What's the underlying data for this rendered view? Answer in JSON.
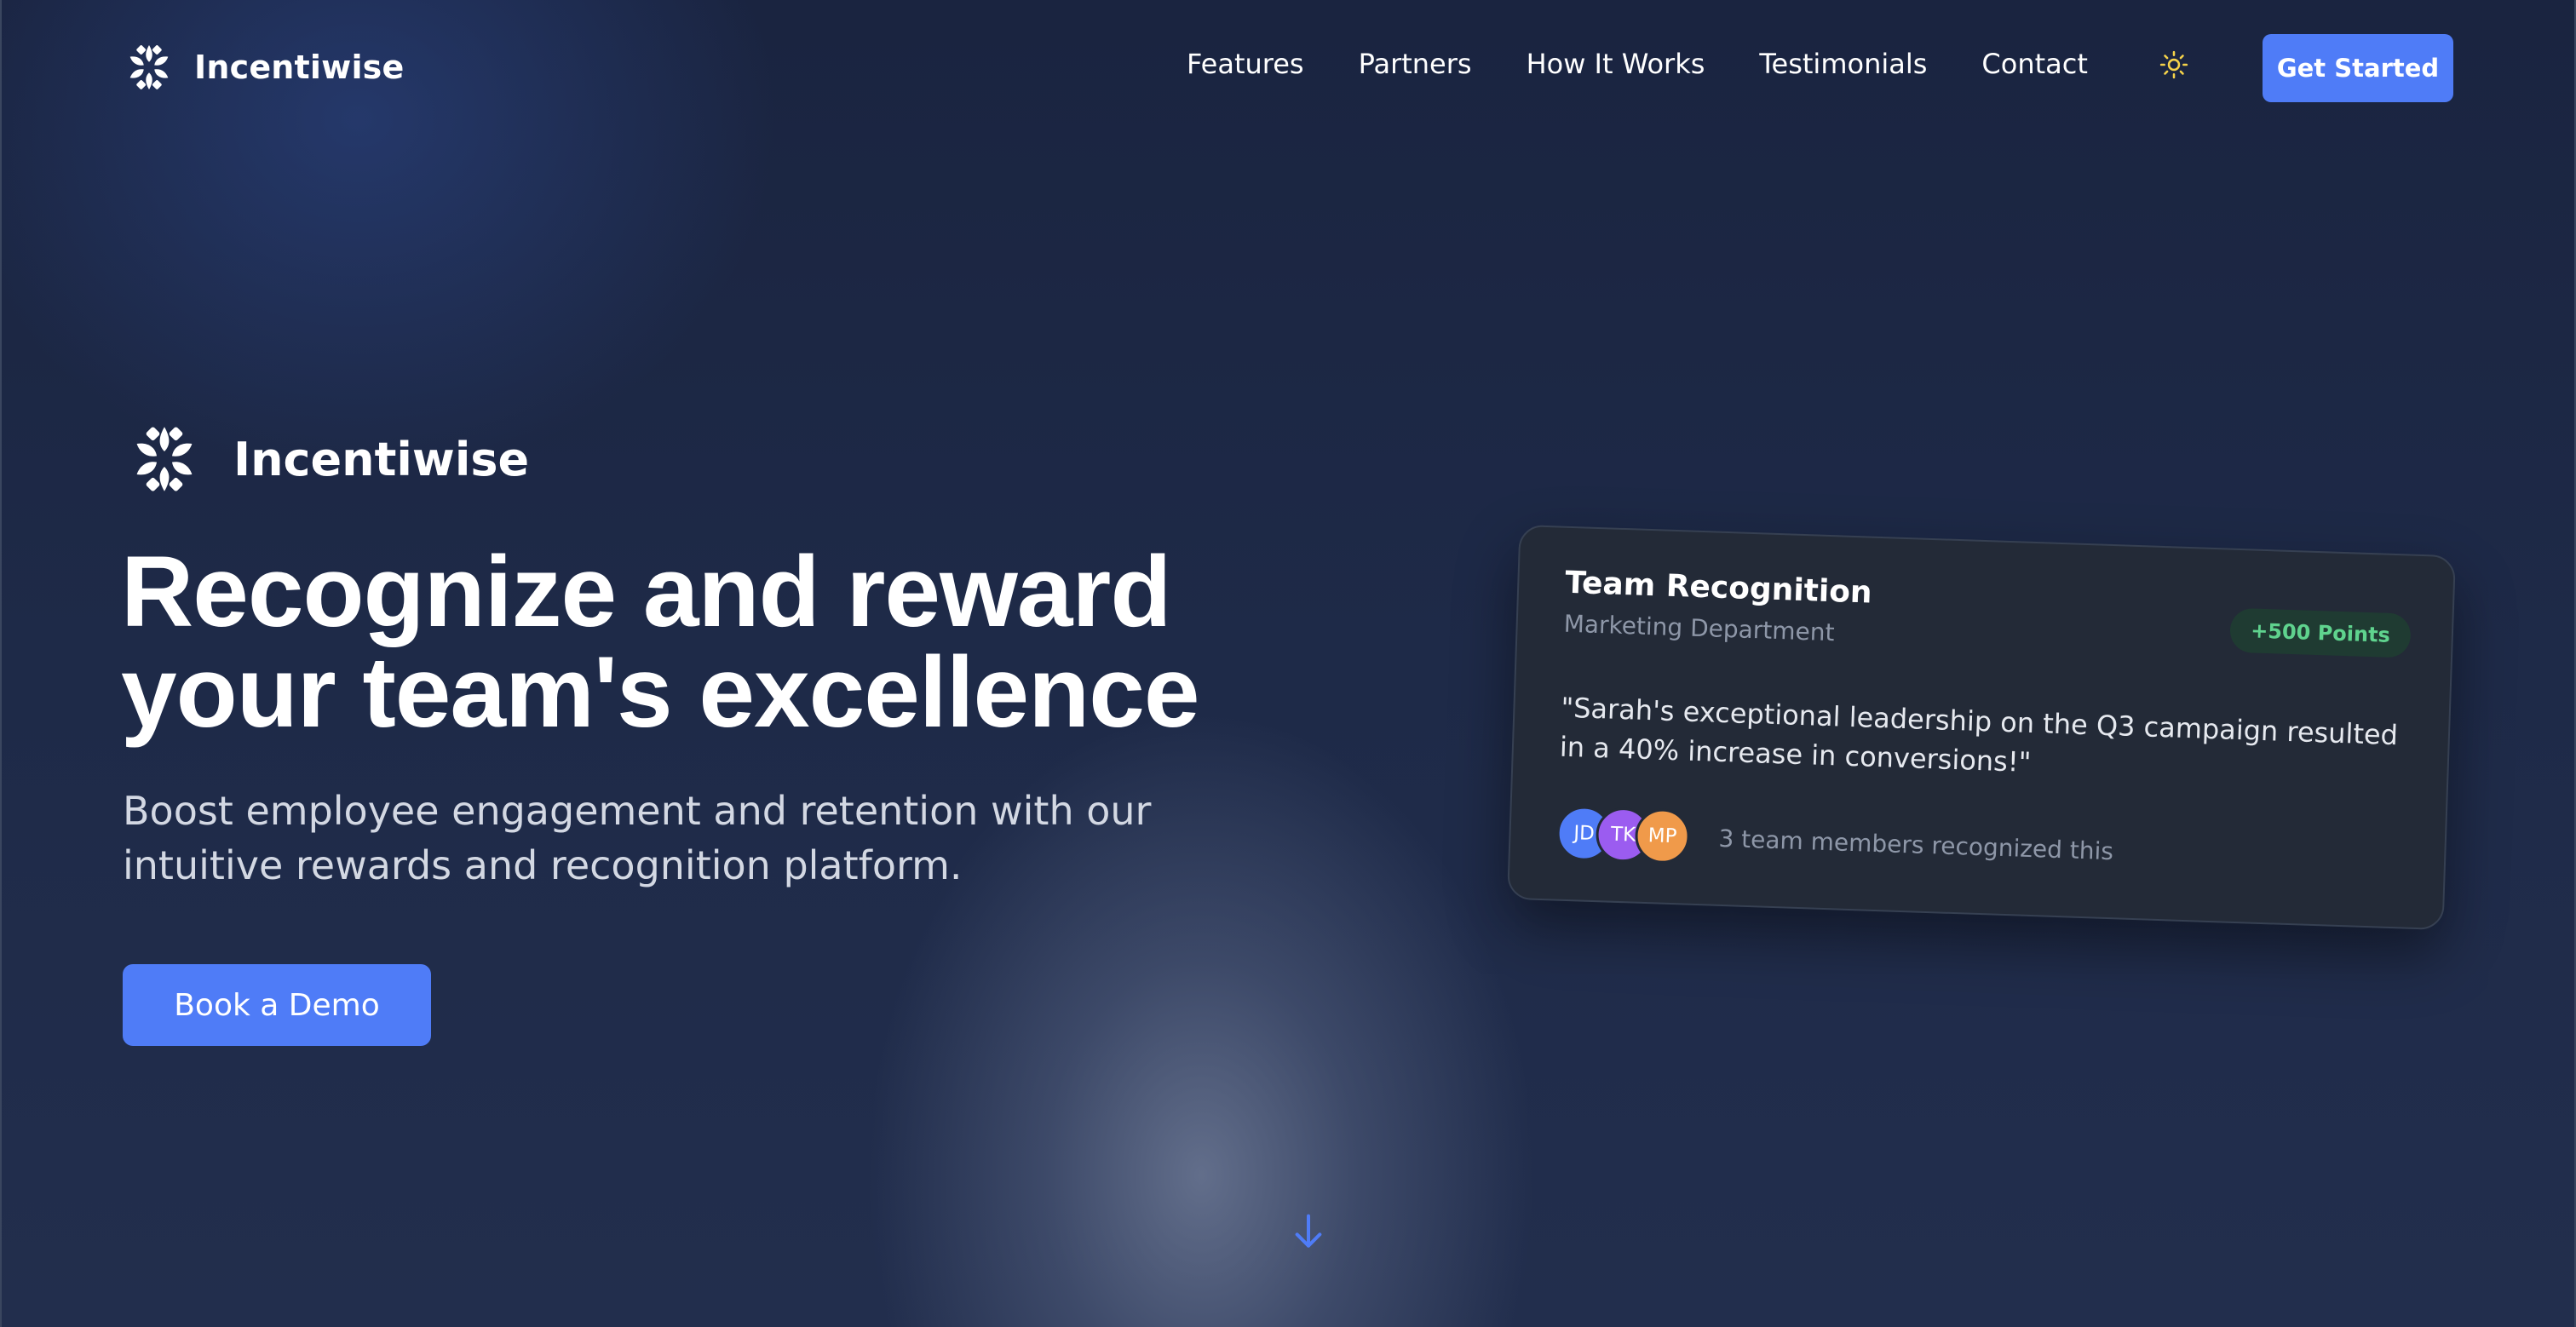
{
  "nav": {
    "brand": "Incentiwise",
    "links": [
      "Features",
      "Partners",
      "How It Works",
      "Testimonials",
      "Contact"
    ],
    "theme_icon": "sun-icon",
    "cta_label": "Get Started"
  },
  "hero": {
    "brand": "Incentiwise",
    "title_line1": "Recognize and reward",
    "title_line2": "your team's excellence",
    "subtitle_line1": "Boost employee engagement and retention with our",
    "subtitle_line2": "intuitive rewards and recognition platform.",
    "cta_label": "Book a Demo"
  },
  "card": {
    "title": "Team Recognition",
    "department": "Marketing Department",
    "badge": "+500 Points",
    "quote": "\"Sarah's exceptional leadership on the Q3 campaign resulted in a 40% increase in conversions!\"",
    "avatars": [
      {
        "initials": "JD",
        "color": "#4f7cf7"
      },
      {
        "initials": "TK",
        "color": "#9b5cf0"
      },
      {
        "initials": "MP",
        "color": "#f09a4a"
      }
    ],
    "recognized_text": "3 team members recognized this"
  },
  "scroll_icon": "arrow-down-icon",
  "colors": {
    "accent": "#4f7cf7",
    "badge_bg": "#1f3b32",
    "badge_text": "#5fd38e",
    "card_bg": "#232a37"
  }
}
